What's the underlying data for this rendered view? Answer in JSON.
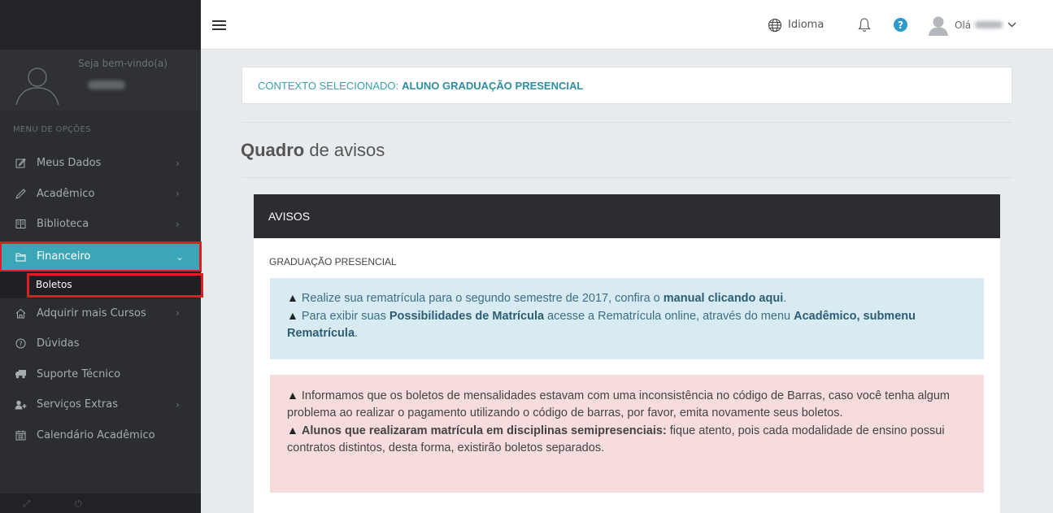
{
  "sidebar": {
    "welcome": "Seja bem-vindo(a)",
    "menu_heading": "MENU DE OPÇÕES",
    "items": [
      {
        "label": "Meus Dados",
        "icon": "edit-icon",
        "has_chevron": true
      },
      {
        "label": "Acadêmico",
        "icon": "pencil-icon",
        "has_chevron": true
      },
      {
        "label": "Biblioteca",
        "icon": "book-icon",
        "has_chevron": true
      },
      {
        "label": "Financeiro",
        "icon": "folder-icon",
        "has_chevron": true,
        "active": true
      },
      {
        "label": "Boletos",
        "submenu": true
      },
      {
        "label": "Adquirir mais Cursos",
        "icon": "home-icon",
        "has_chevron": true
      },
      {
        "label": "Dúvidas",
        "icon": "question-circle-icon",
        "has_chevron": false
      },
      {
        "label": "Suporte Técnico",
        "icon": "truck-icon",
        "has_chevron": false
      },
      {
        "label": "Serviços Extras",
        "icon": "user-plus-icon",
        "has_chevron": true
      },
      {
        "label": "Calendário Acadêmico",
        "icon": "calendar-icon",
        "has_chevron": false
      }
    ]
  },
  "topbar": {
    "language_label": "Idioma",
    "greeting": "Olá"
  },
  "context": {
    "prefix": "CONTEXTO SELECIONADO:",
    "value": "ALUNO GRADUAÇÃO PRESENCIAL"
  },
  "page": {
    "title_bold": "Quadro",
    "title_rest": " de avisos"
  },
  "panel": {
    "header": "AVISOS",
    "subheader": "GRADUAÇÃO PRESENCIAL",
    "info": {
      "line1_text": "Realize sua rematrícula para o segundo semestre de 2017, confira o ",
      "line1_link": "manual clicando aqui",
      "line1_end": ".",
      "line2_text": "Para exibir suas ",
      "line2_bold1": "Possibilidades de Matrícula",
      "line2_mid": " acesse a Rematrícula online, através do menu ",
      "line2_bold2": "Acadêmico, submenu Rematrícula",
      "line2_end": "."
    },
    "danger": {
      "line1": "Informamos que os boletos de mensalidades estavam com uma inconsistência no código de Barras, caso você tenha algum problema ao realizar o pagamento utilizando o código de barras, por favor, emita novamente seus boletos.",
      "line2_bold": "Alunos que realizaram matrícula em disciplinas semipresenciais:",
      "line2_text": " fique atento, pois cada modalidade de ensino possui contratos distintos, desta forma, existirão boletos separados."
    }
  },
  "colors": {
    "accent": "#3ba7b6",
    "highlight_border": "#e01c24",
    "sidebar_bg": "#2b2d30",
    "info_bg": "#d9ebf2",
    "danger_bg": "#f6dcdc"
  }
}
